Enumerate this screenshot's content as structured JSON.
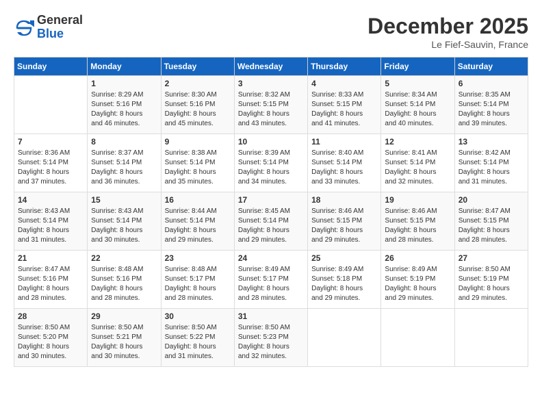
{
  "header": {
    "logo": {
      "general": "General",
      "blue": "Blue"
    },
    "title": "December 2025",
    "subtitle": "Le Fief-Sauvin, France"
  },
  "days_of_week": [
    "Sunday",
    "Monday",
    "Tuesday",
    "Wednesday",
    "Thursday",
    "Friday",
    "Saturday"
  ],
  "weeks": [
    [
      {
        "day": "",
        "info": ""
      },
      {
        "day": "1",
        "info": "Sunrise: 8:29 AM\nSunset: 5:16 PM\nDaylight: 8 hours\nand 46 minutes."
      },
      {
        "day": "2",
        "info": "Sunrise: 8:30 AM\nSunset: 5:16 PM\nDaylight: 8 hours\nand 45 minutes."
      },
      {
        "day": "3",
        "info": "Sunrise: 8:32 AM\nSunset: 5:15 PM\nDaylight: 8 hours\nand 43 minutes."
      },
      {
        "day": "4",
        "info": "Sunrise: 8:33 AM\nSunset: 5:15 PM\nDaylight: 8 hours\nand 41 minutes."
      },
      {
        "day": "5",
        "info": "Sunrise: 8:34 AM\nSunset: 5:14 PM\nDaylight: 8 hours\nand 40 minutes."
      },
      {
        "day": "6",
        "info": "Sunrise: 8:35 AM\nSunset: 5:14 PM\nDaylight: 8 hours\nand 39 minutes."
      }
    ],
    [
      {
        "day": "7",
        "info": "Sunrise: 8:36 AM\nSunset: 5:14 PM\nDaylight: 8 hours\nand 37 minutes."
      },
      {
        "day": "8",
        "info": "Sunrise: 8:37 AM\nSunset: 5:14 PM\nDaylight: 8 hours\nand 36 minutes."
      },
      {
        "day": "9",
        "info": "Sunrise: 8:38 AM\nSunset: 5:14 PM\nDaylight: 8 hours\nand 35 minutes."
      },
      {
        "day": "10",
        "info": "Sunrise: 8:39 AM\nSunset: 5:14 PM\nDaylight: 8 hours\nand 34 minutes."
      },
      {
        "day": "11",
        "info": "Sunrise: 8:40 AM\nSunset: 5:14 PM\nDaylight: 8 hours\nand 33 minutes."
      },
      {
        "day": "12",
        "info": "Sunrise: 8:41 AM\nSunset: 5:14 PM\nDaylight: 8 hours\nand 32 minutes."
      },
      {
        "day": "13",
        "info": "Sunrise: 8:42 AM\nSunset: 5:14 PM\nDaylight: 8 hours\nand 31 minutes."
      }
    ],
    [
      {
        "day": "14",
        "info": "Sunrise: 8:43 AM\nSunset: 5:14 PM\nDaylight: 8 hours\nand 31 minutes."
      },
      {
        "day": "15",
        "info": "Sunrise: 8:43 AM\nSunset: 5:14 PM\nDaylight: 8 hours\nand 30 minutes."
      },
      {
        "day": "16",
        "info": "Sunrise: 8:44 AM\nSunset: 5:14 PM\nDaylight: 8 hours\nand 29 minutes."
      },
      {
        "day": "17",
        "info": "Sunrise: 8:45 AM\nSunset: 5:14 PM\nDaylight: 8 hours\nand 29 minutes."
      },
      {
        "day": "18",
        "info": "Sunrise: 8:46 AM\nSunset: 5:15 PM\nDaylight: 8 hours\nand 29 minutes."
      },
      {
        "day": "19",
        "info": "Sunrise: 8:46 AM\nSunset: 5:15 PM\nDaylight: 8 hours\nand 28 minutes."
      },
      {
        "day": "20",
        "info": "Sunrise: 8:47 AM\nSunset: 5:15 PM\nDaylight: 8 hours\nand 28 minutes."
      }
    ],
    [
      {
        "day": "21",
        "info": "Sunrise: 8:47 AM\nSunset: 5:16 PM\nDaylight: 8 hours\nand 28 minutes."
      },
      {
        "day": "22",
        "info": "Sunrise: 8:48 AM\nSunset: 5:16 PM\nDaylight: 8 hours\nand 28 minutes."
      },
      {
        "day": "23",
        "info": "Sunrise: 8:48 AM\nSunset: 5:17 PM\nDaylight: 8 hours\nand 28 minutes."
      },
      {
        "day": "24",
        "info": "Sunrise: 8:49 AM\nSunset: 5:17 PM\nDaylight: 8 hours\nand 28 minutes."
      },
      {
        "day": "25",
        "info": "Sunrise: 8:49 AM\nSunset: 5:18 PM\nDaylight: 8 hours\nand 29 minutes."
      },
      {
        "day": "26",
        "info": "Sunrise: 8:49 AM\nSunset: 5:19 PM\nDaylight: 8 hours\nand 29 minutes."
      },
      {
        "day": "27",
        "info": "Sunrise: 8:50 AM\nSunset: 5:19 PM\nDaylight: 8 hours\nand 29 minutes."
      }
    ],
    [
      {
        "day": "28",
        "info": "Sunrise: 8:50 AM\nSunset: 5:20 PM\nDaylight: 8 hours\nand 30 minutes."
      },
      {
        "day": "29",
        "info": "Sunrise: 8:50 AM\nSunset: 5:21 PM\nDaylight: 8 hours\nand 30 minutes."
      },
      {
        "day": "30",
        "info": "Sunrise: 8:50 AM\nSunset: 5:22 PM\nDaylight: 8 hours\nand 31 minutes."
      },
      {
        "day": "31",
        "info": "Sunrise: 8:50 AM\nSunset: 5:23 PM\nDaylight: 8 hours\nand 32 minutes."
      },
      {
        "day": "",
        "info": ""
      },
      {
        "day": "",
        "info": ""
      },
      {
        "day": "",
        "info": ""
      }
    ]
  ]
}
